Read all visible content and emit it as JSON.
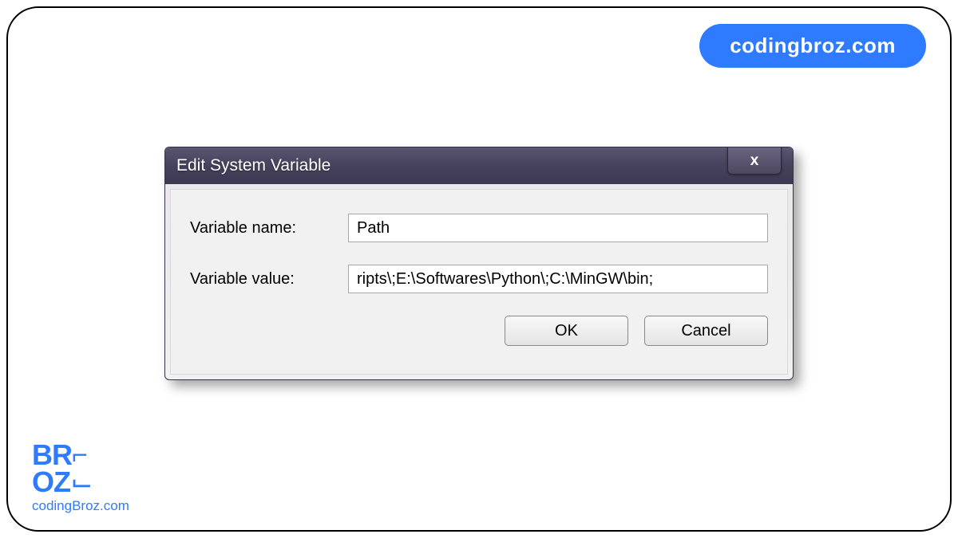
{
  "badge": {
    "text": "codingbroz.com"
  },
  "dialog": {
    "title": "Edit System Variable",
    "close_symbol": "x",
    "rows": {
      "name": {
        "label": "Variable name:",
        "value": "Path"
      },
      "value": {
        "label": "Variable value:",
        "value": "ripts\\;E:\\Softwares\\Python\\;C:\\MinGW\\bin;"
      }
    },
    "buttons": {
      "ok": "OK",
      "cancel": "Cancel"
    }
  },
  "logo": {
    "line1": "BR",
    "line2": "OZ",
    "bracket_top": "⌐",
    "bracket_bot": "⌙",
    "comma": ",",
    "sub": "codingBroz.com"
  }
}
